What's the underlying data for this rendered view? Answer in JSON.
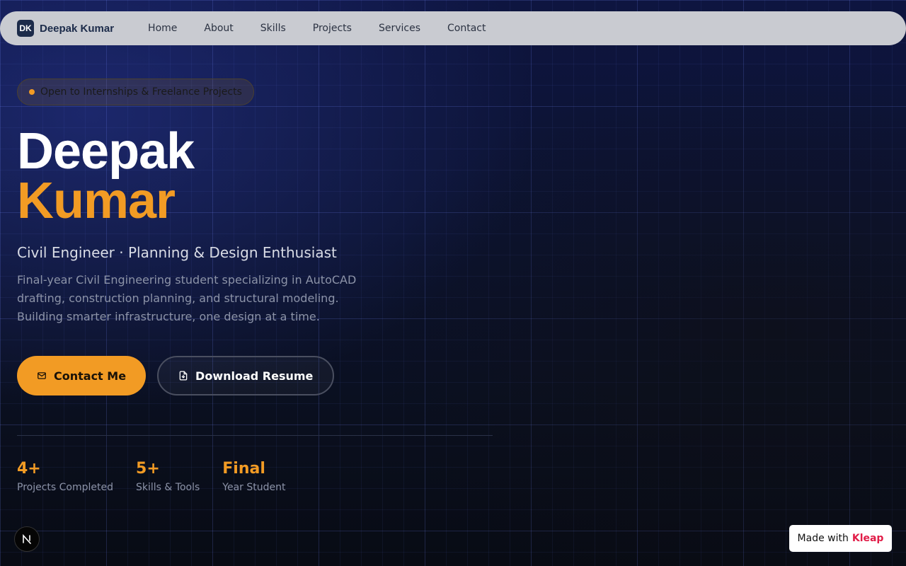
{
  "nav": {
    "logo_initials": "DK",
    "logo_name": "Deepak Kumar",
    "links": [
      "Home",
      "About",
      "Skills",
      "Projects",
      "Services",
      "Contact"
    ]
  },
  "hero": {
    "status_pill": "Open to Internships & Freelance Projects",
    "first_name": "Deepak",
    "last_name": "Kumar",
    "tagline": "Civil Engineer · Planning & Design Enthusiast",
    "description": "Final-year Civil Engineering student specializing in AutoCAD drafting, construction planning, and structural modeling. Building smarter infrastructure, one design at a time.",
    "contact_button": "Contact Me",
    "resume_button": "Download Resume"
  },
  "stats": [
    {
      "value": "4+",
      "label": "Projects Completed"
    },
    {
      "value": "5+",
      "label": "Skills & Tools"
    },
    {
      "value": "Final",
      "label": "Year Student"
    }
  ],
  "footer_badge": {
    "made_with": "Made with",
    "brand": "Kleap",
    "n_logo": "N"
  },
  "colors": {
    "accent": "#f29b24",
    "nav_bg": "#c9cbd1",
    "logo_bg": "#1c2b4a",
    "brand_pink": "#e11d48"
  },
  "icons": {
    "contact": "mail-icon",
    "resume": "file-download-icon"
  }
}
